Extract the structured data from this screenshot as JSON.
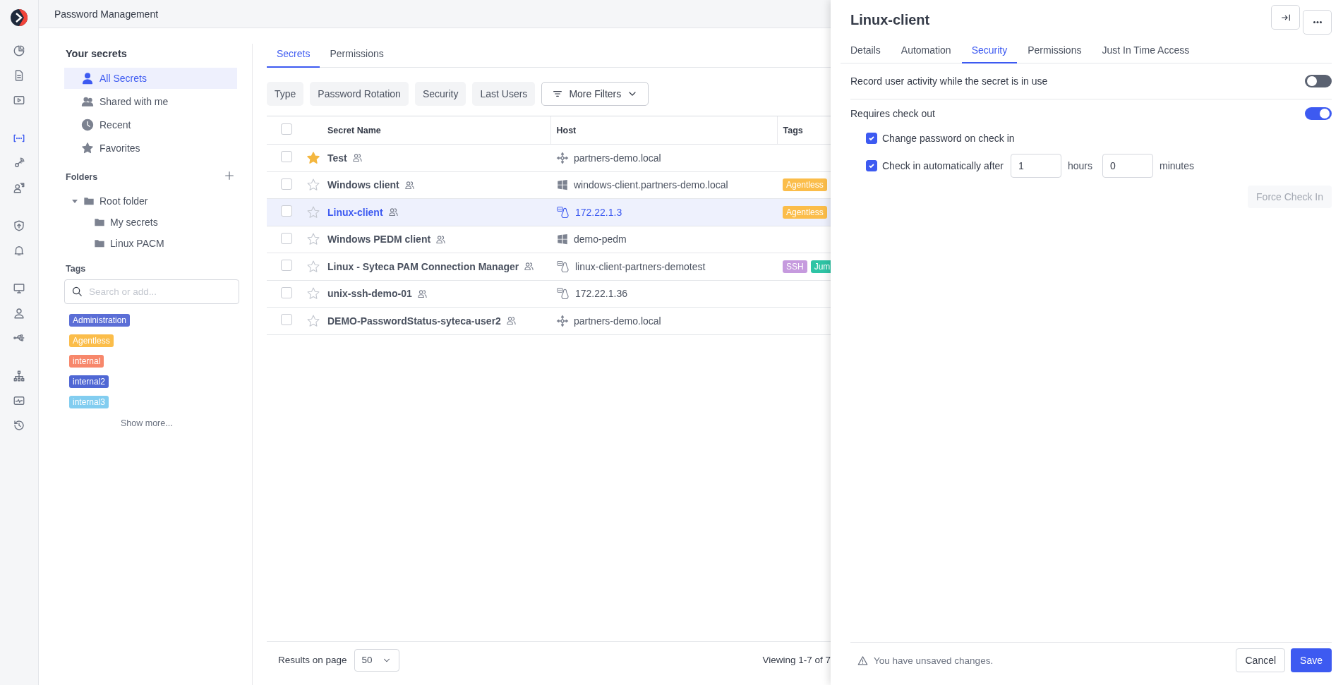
{
  "app": {
    "title": "Password Management"
  },
  "rail_groups": [
    {
      "items": [
        {
          "kind": "chart",
          "selected": false
        },
        {
          "kind": "document",
          "selected": false
        },
        {
          "kind": "play",
          "selected": false
        }
      ]
    },
    {
      "items": [
        {
          "kind": "secrets",
          "selected": true
        },
        {
          "kind": "key",
          "selected": false
        },
        {
          "kind": "user-question",
          "selected": false
        }
      ]
    },
    {
      "items": [
        {
          "kind": "shield",
          "selected": false
        },
        {
          "kind": "bell",
          "selected": false
        }
      ]
    },
    {
      "items": [
        {
          "kind": "monitor",
          "selected": false
        },
        {
          "kind": "user",
          "selected": false
        },
        {
          "kind": "usb",
          "selected": false
        }
      ]
    },
    {
      "items": [
        {
          "kind": "hierarchy",
          "selected": false
        },
        {
          "kind": "activity",
          "selected": false
        },
        {
          "kind": "history",
          "selected": false
        }
      ]
    }
  ],
  "secrets_nav": {
    "heading": "Your secrets",
    "items": [
      {
        "label": "All Secrets",
        "kind": "user",
        "selected": true
      },
      {
        "label": "Shared with me",
        "kind": "users",
        "selected": false
      },
      {
        "label": "Recent",
        "kind": "clock",
        "selected": false
      },
      {
        "label": "Favorites",
        "kind": "star",
        "selected": false
      }
    ]
  },
  "folders": {
    "heading": "Folders",
    "tree": [
      {
        "label": "Root folder",
        "expanded": true,
        "children": [
          {
            "label": "My secrets"
          },
          {
            "label": "Linux PACM"
          }
        ]
      }
    ]
  },
  "tags": {
    "heading": "Tags",
    "search": {
      "placeholder": "Search or add..."
    },
    "items": [
      {
        "label": "Administration",
        "color": "#5b6ed6"
      },
      {
        "label": "Agentless",
        "color": "#fbbd4a"
      },
      {
        "label": "internal",
        "color": "#f7876b"
      },
      {
        "label": "internal2",
        "color": "#4f67d4"
      },
      {
        "label": "internal3",
        "color": "#82cdf0"
      }
    ],
    "show_more": "Show more..."
  },
  "main_tabs": [
    {
      "label": "Secrets",
      "selected": true
    },
    {
      "label": "Permissions",
      "selected": false
    }
  ],
  "filters": [
    {
      "label": "Type",
      "kind": "chip"
    },
    {
      "label": "Password Rotation",
      "kind": "chip"
    },
    {
      "label": "Security",
      "kind": "chip"
    },
    {
      "label": "Last Users",
      "kind": "chip"
    },
    {
      "label": "More Filters",
      "kind": "dropdown"
    }
  ],
  "table": {
    "columns": [
      "Secret Name",
      "Host",
      "Tags"
    ],
    "all_checked": false,
    "rows": [
      {
        "name": "Test",
        "favorite": true,
        "selected": false,
        "checked": false,
        "host": {
          "name": "partners-demo.local",
          "kind": "domain"
        },
        "tags": []
      },
      {
        "name": "Windows client",
        "favorite": false,
        "selected": false,
        "checked": false,
        "host": {
          "name": "windows-client.partners-demo.local",
          "kind": "windows"
        },
        "tags": [
          {
            "label": "Agentless",
            "color": "#fbbd4a"
          }
        ]
      },
      {
        "name": "Linux-client",
        "favorite": false,
        "selected": true,
        "checked": false,
        "host": {
          "name": "172.22.1.3",
          "kind": "ssh"
        },
        "tags": [
          {
            "label": "Agentless",
            "color": "#fbbd4a"
          }
        ]
      },
      {
        "name": "Windows PEDM client",
        "favorite": false,
        "selected": false,
        "checked": false,
        "host": {
          "name": "demo-pedm",
          "kind": "windows"
        },
        "tags": []
      },
      {
        "name": "Linux - Syteca PAM Connection Manager",
        "favorite": false,
        "selected": false,
        "checked": false,
        "host": {
          "name": "linux-client-partners-demotest",
          "kind": "ssh"
        },
        "tags": [
          {
            "label": "SSH",
            "color": "#c69ade"
          },
          {
            "label": "Jum",
            "color": "#2ec4a5"
          }
        ]
      },
      {
        "name": "unix-ssh-demo-01",
        "favorite": false,
        "selected": false,
        "checked": false,
        "host": {
          "name": "172.22.1.36",
          "kind": "ssh"
        },
        "tags": []
      },
      {
        "name": "DEMO-PasswordStatus-syteca-user2",
        "favorite": false,
        "selected": false,
        "checked": false,
        "host": {
          "name": "partners-demo.local",
          "kind": "domain"
        },
        "tags": []
      }
    ]
  },
  "pager": {
    "label": "Results on page",
    "page_size": "50",
    "viewing": "Viewing 1-7 of 7"
  },
  "drawer": {
    "title": "Linux-client",
    "tabs": [
      {
        "label": "Details",
        "selected": false
      },
      {
        "label": "Automation",
        "selected": false
      },
      {
        "label": "Security",
        "selected": true
      },
      {
        "label": "Permissions",
        "selected": false
      },
      {
        "label": "Just In Time Access",
        "selected": false
      }
    ],
    "record": {
      "label": "Record user activity while the secret is in use",
      "on": false
    },
    "checkout": {
      "label": "Requires check out",
      "on": true,
      "change_password": {
        "label": "Change password on check in",
        "checked": true
      },
      "auto_checkin": {
        "label": "Check in automatically after",
        "checked": true,
        "hours": "1",
        "hours_unit": "hours",
        "minutes": "0",
        "minutes_unit": "minutes"
      }
    },
    "force_check_in": {
      "label": "Force Check In",
      "disabled": true
    },
    "footer": {
      "warning": "You have unsaved changes.",
      "cancel": "Cancel",
      "save": "Save"
    }
  }
}
